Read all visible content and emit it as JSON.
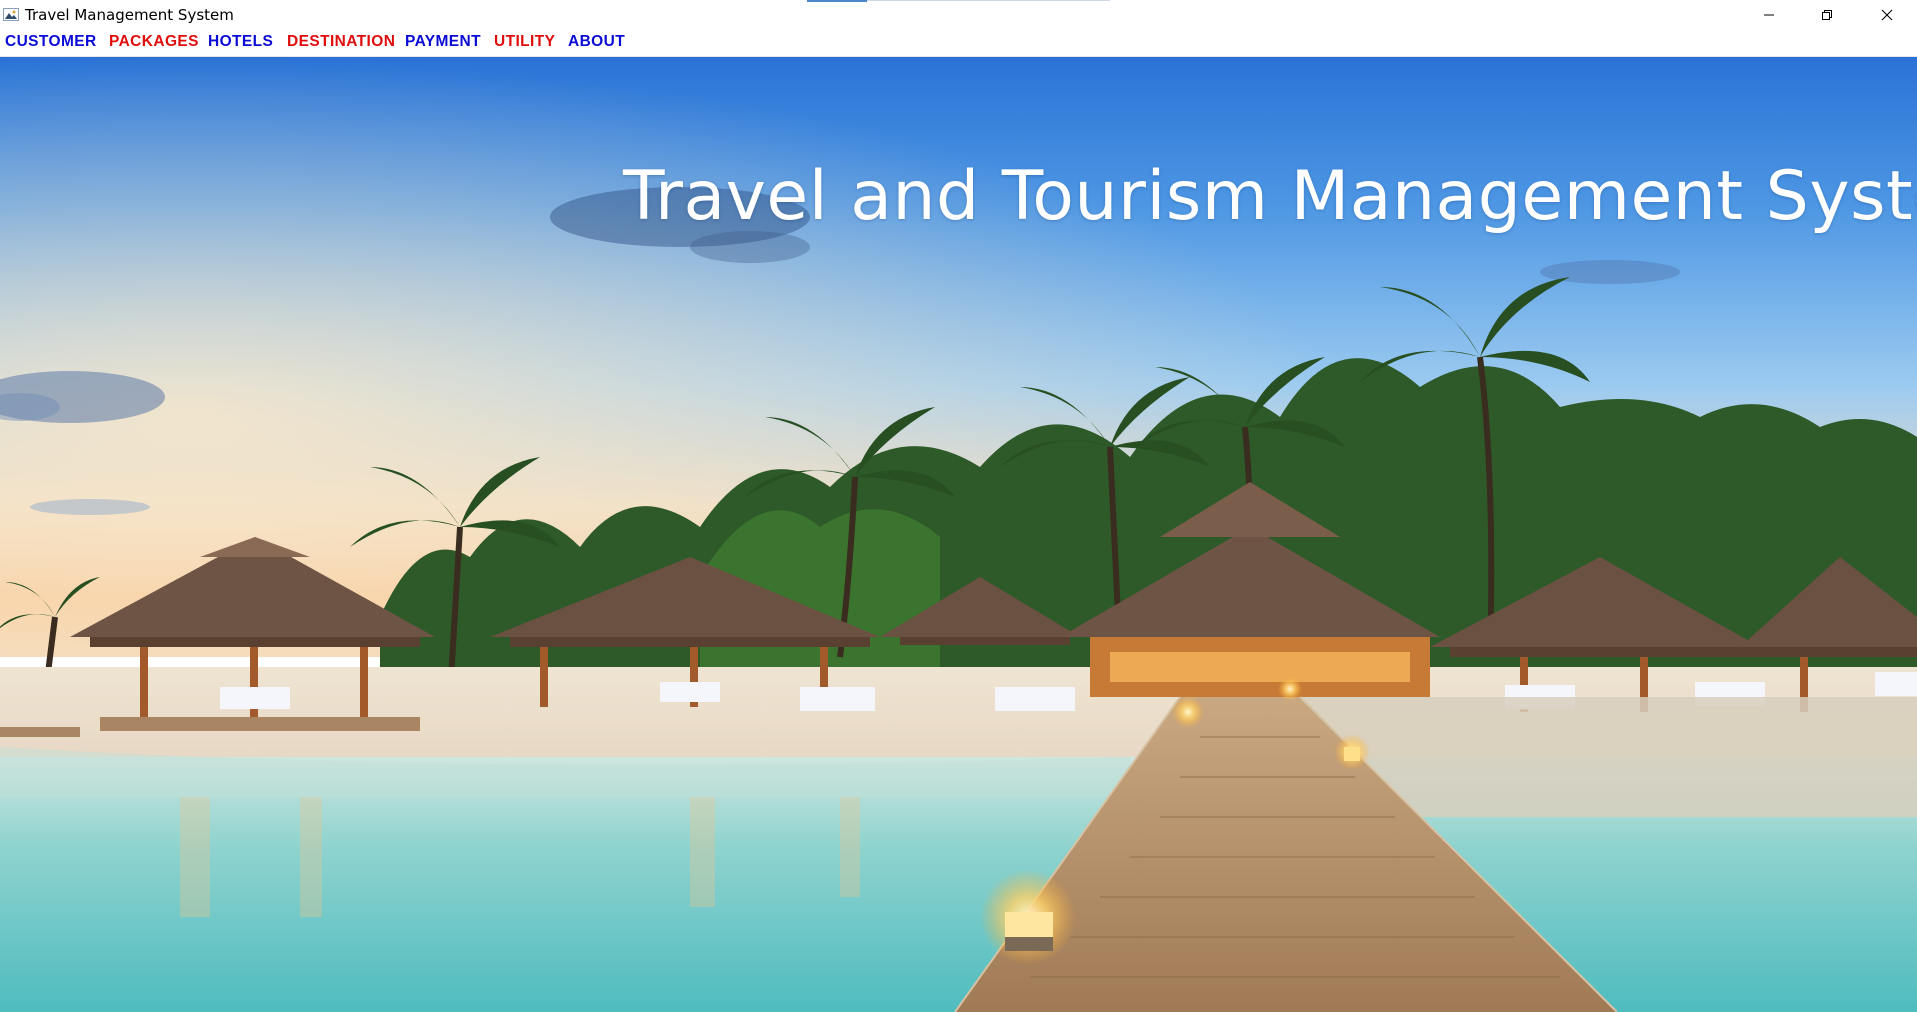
{
  "window": {
    "title": "Travel Management System",
    "controls": {
      "minimize": "minimize-icon",
      "maximize": "restore-icon",
      "close": "close-icon"
    }
  },
  "menu": {
    "items": [
      {
        "label": "CUSTOMER",
        "color": "#0b0bd6"
      },
      {
        "label": "PACKAGES",
        "color": "#e00d0d"
      },
      {
        "label": "HOTELS",
        "color": "#0b0bd6"
      },
      {
        "label": "DESTINATION",
        "color": "#e00d0d"
      },
      {
        "label": "PAYMENT",
        "color": "#0b0bd6"
      },
      {
        "label": "UTILITY",
        "color": "#e00d0d"
      },
      {
        "label": "ABOUT",
        "color": "#0b0bd6"
      }
    ]
  },
  "hero": {
    "headline": "Travel and Tourism Management System",
    "image": "beach-resort-background",
    "colors": {
      "sky_top": "#1c6fd6",
      "sky_mid": "#7fb8e8",
      "horizon": "#f4d3a0",
      "water": "#7ad0cf",
      "sand": "#e8dccb",
      "thatch": "#6e5444"
    }
  }
}
